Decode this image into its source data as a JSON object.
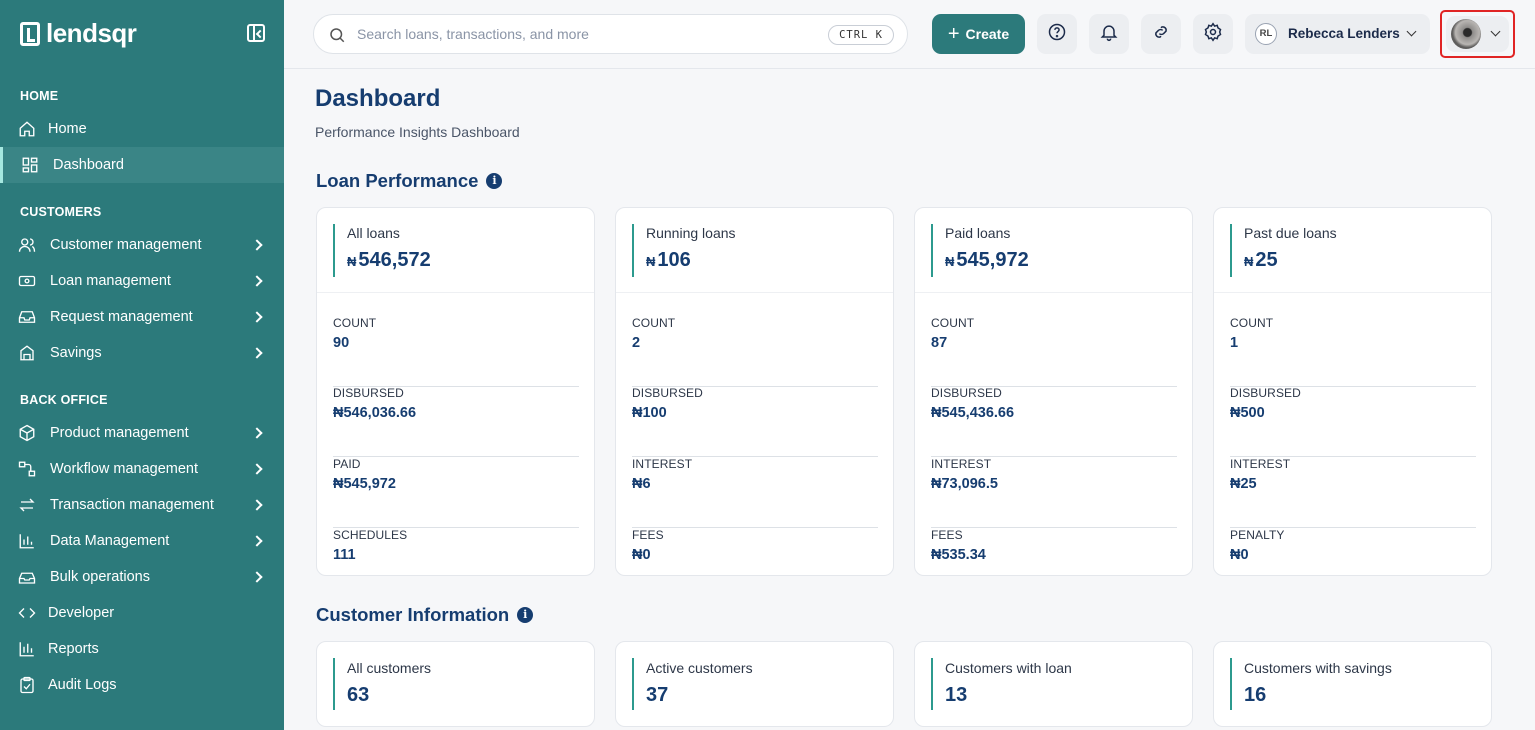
{
  "app": {
    "brand": "lendsqr"
  },
  "sidebar": {
    "sections": [
      {
        "title": "HOME"
      },
      {
        "title": "CUSTOMERS"
      },
      {
        "title": "BACK OFFICE"
      }
    ],
    "items": [
      {
        "label": "Home",
        "icon": "home-icon"
      },
      {
        "label": "Dashboard",
        "icon": "dashboard-icon",
        "active": true
      },
      {
        "label": "Customer management",
        "icon": "users-icon"
      },
      {
        "label": "Loan management",
        "icon": "loan-icon"
      },
      {
        "label": "Request management",
        "icon": "inbox-icon"
      },
      {
        "label": "Savings",
        "icon": "savings-icon"
      },
      {
        "label": "Product management",
        "icon": "box-icon"
      },
      {
        "label": "Workflow management",
        "icon": "workflow-icon"
      },
      {
        "label": "Transaction management",
        "icon": "transfer-icon"
      },
      {
        "label": "Data Management",
        "icon": "chart-icon"
      },
      {
        "label": "Bulk operations",
        "icon": "bulk-icon"
      },
      {
        "label": "Developer",
        "icon": "code-icon"
      },
      {
        "label": "Reports",
        "icon": "reports-icon"
      },
      {
        "label": "Audit Logs",
        "icon": "clipboard-icon"
      }
    ]
  },
  "topbar": {
    "search_placeholder": "Search loans, transactions, and more",
    "shortcut": "CTRL K",
    "create_label": "Create",
    "org_initials": "RL",
    "org_name": "Rebecca Lenders"
  },
  "page": {
    "title": "Dashboard",
    "subtitle": "Performance Insights Dashboard"
  },
  "loan_performance": {
    "title": "Loan Performance",
    "cards": [
      {
        "title": "All loans",
        "currency": "₦",
        "amount": "546,572",
        "stats": [
          {
            "k": "COUNT",
            "v": "90"
          },
          {
            "k": "DISBURSED",
            "v": "₦546,036.66"
          },
          {
            "k": "PAID",
            "v": "₦545,972"
          },
          {
            "k": "SCHEDULES",
            "v": "111"
          }
        ]
      },
      {
        "title": "Running loans",
        "currency": "₦",
        "amount": "106",
        "stats": [
          {
            "k": "COUNT",
            "v": "2"
          },
          {
            "k": "DISBURSED",
            "v": "₦100"
          },
          {
            "k": "INTEREST",
            "v": "₦6"
          },
          {
            "k": "FEES",
            "v": "₦0"
          }
        ]
      },
      {
        "title": "Paid loans",
        "currency": "₦",
        "amount": "545,972",
        "stats": [
          {
            "k": "COUNT",
            "v": "87"
          },
          {
            "k": "DISBURSED",
            "v": "₦545,436.66"
          },
          {
            "k": "INTEREST",
            "v": "₦73,096.5"
          },
          {
            "k": "FEES",
            "v": "₦535.34"
          }
        ]
      },
      {
        "title": "Past due loans",
        "currency": "₦",
        "amount": "25",
        "stats": [
          {
            "k": "COUNT",
            "v": "1"
          },
          {
            "k": "DISBURSED",
            "v": "₦500"
          },
          {
            "k": "INTEREST",
            "v": "₦25"
          },
          {
            "k": "PENALTY",
            "v": "₦0"
          }
        ]
      }
    ]
  },
  "customer_information": {
    "title": "Customer Information",
    "cards": [
      {
        "title": "All customers",
        "value": "63"
      },
      {
        "title": "Active customers",
        "value": "37"
      },
      {
        "title": "Customers with loan",
        "value": "13"
      },
      {
        "title": "Customers with savings",
        "value": "16"
      }
    ]
  },
  "colors": {
    "sidebar": "#2c7a7b",
    "accent": "#2c7a7b",
    "heading": "#163d70",
    "highlight_border": "#e02424"
  }
}
